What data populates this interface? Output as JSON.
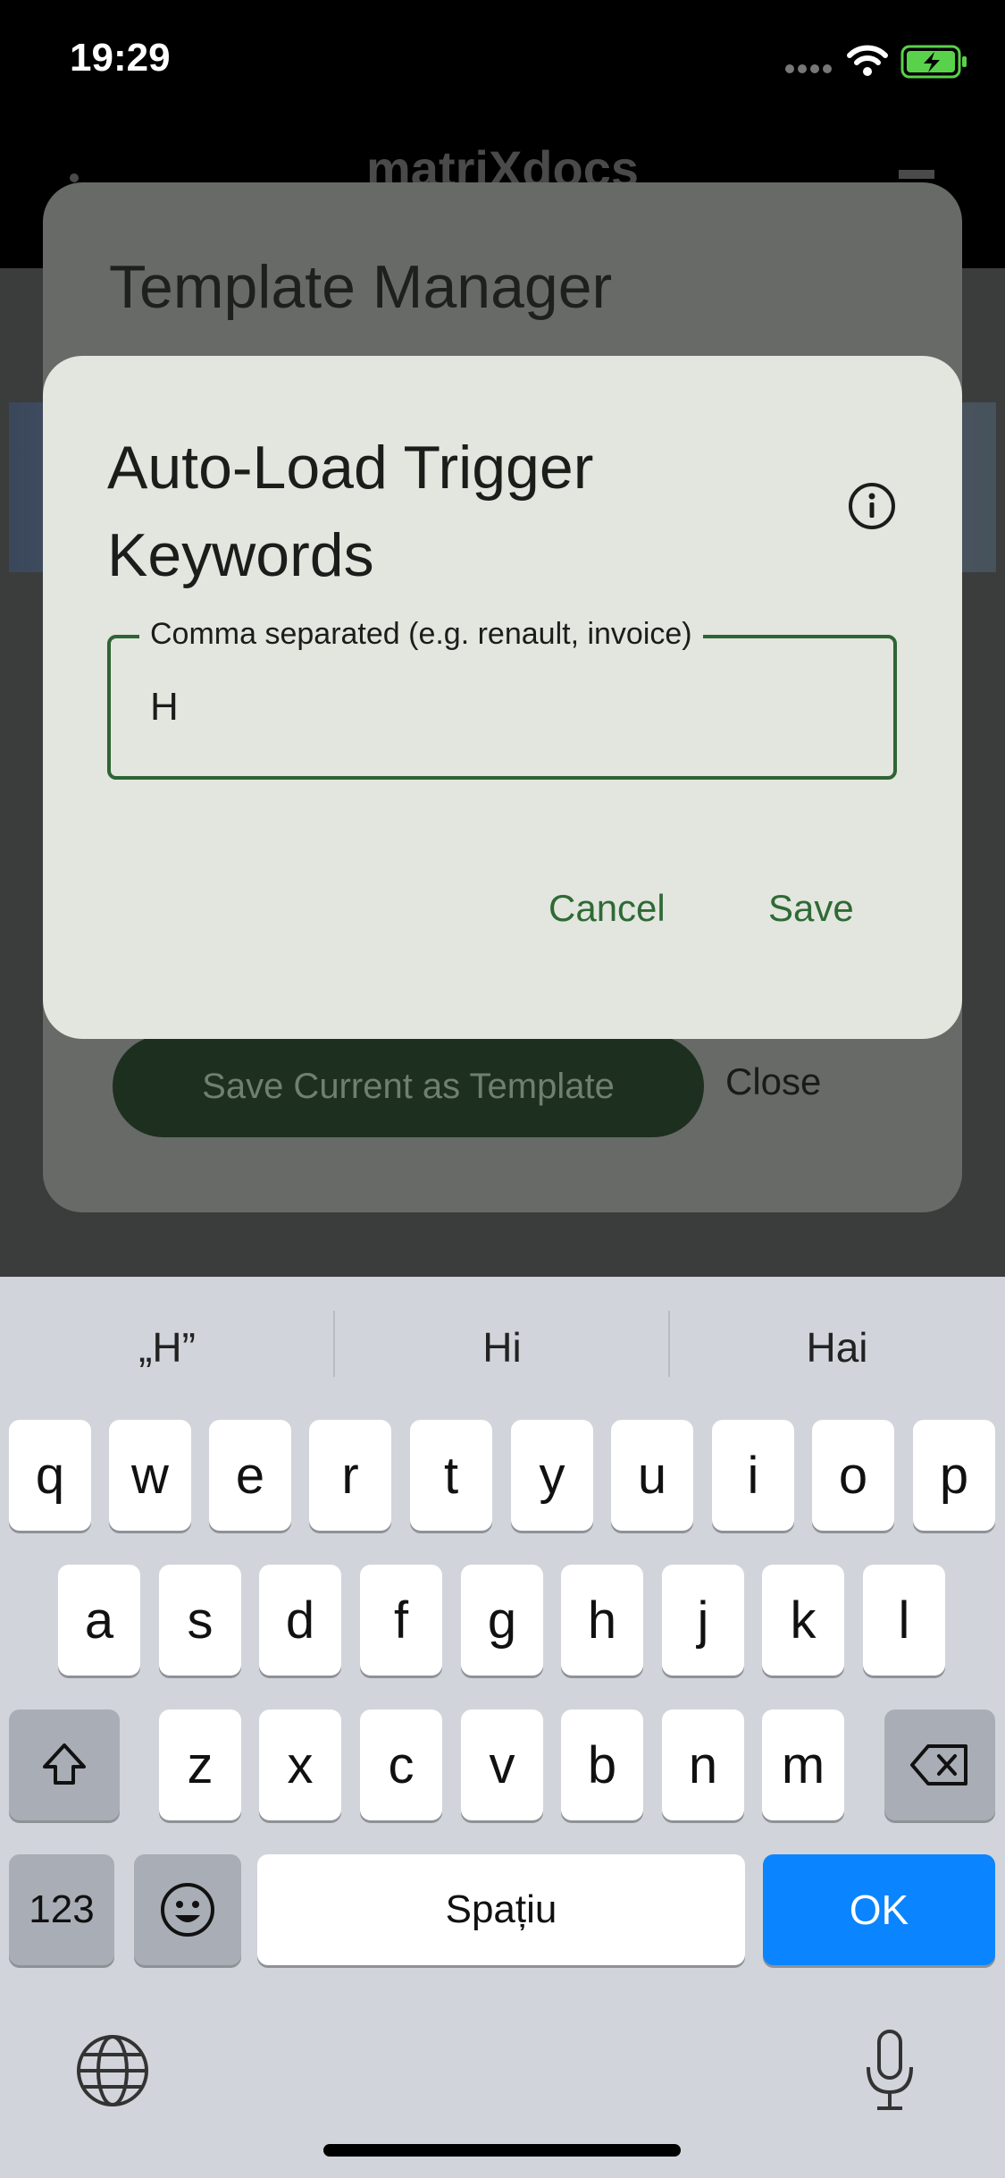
{
  "status_bar": {
    "time": "19:29"
  },
  "app_bar": {
    "title": "matriXdocs"
  },
  "template_manager": {
    "title": "Template Manager",
    "save_button": "Save Current as Template",
    "close_button": "Close"
  },
  "keywords_dialog": {
    "title": "Auto-Load Trigger Keywords",
    "field_label": "Comma separated (e.g. renault, invoice)",
    "field_value": "H",
    "cancel_label": "Cancel",
    "save_label": "Save"
  },
  "keyboard": {
    "suggestions": [
      "„H”",
      "Hi",
      "Hai"
    ],
    "row1": [
      "q",
      "w",
      "e",
      "r",
      "t",
      "y",
      "u",
      "i",
      "o",
      "p"
    ],
    "row2": [
      "a",
      "s",
      "d",
      "f",
      "g",
      "h",
      "j",
      "k",
      "l"
    ],
    "row3": [
      "z",
      "x",
      "c",
      "v",
      "b",
      "n",
      "m"
    ],
    "numbers_key": "123",
    "space_key": "Spațiu",
    "ok_key": "OK"
  },
  "colors": {
    "accent_green": "#2f6a35",
    "ok_blue": "#0b84ff"
  }
}
